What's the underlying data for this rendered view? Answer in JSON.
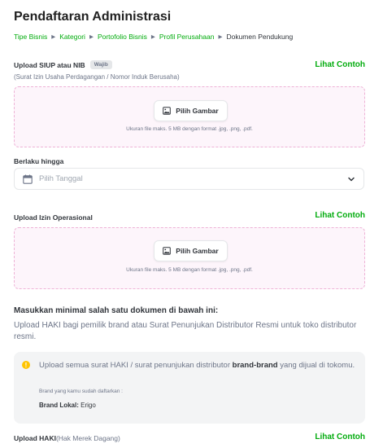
{
  "page": {
    "title": "Pendaftaran Administrasi"
  },
  "breadcrumb": [
    {
      "label": "Tipe Bisnis"
    },
    {
      "label": "Kategori"
    },
    {
      "label": "Portofolio Bisnis"
    },
    {
      "label": "Profil Perusahaan"
    },
    {
      "label": "Dokumen Pendukung"
    }
  ],
  "siup": {
    "label": "Upload SIUP atau NIB",
    "badge": "Wajib",
    "subtext": "(Surat Izin Usaha Perdagangan / Nomor Induk Berusaha)",
    "example_link": "Lihat Contoh",
    "button_label": "Pilih Gambar",
    "hint": "Ukuran file maks. 5 MB dengan format .jpg, .png, .pdf."
  },
  "valid_until": {
    "label": "Berlaku hingga",
    "placeholder": "Pilih Tanggal"
  },
  "izin": {
    "label": "Upload Izin Operasional",
    "example_link": "Lihat Contoh",
    "button_label": "Pilih Gambar",
    "hint": "Ukuran file maks. 5 MB dengan format .jpg, .png, .pdf."
  },
  "min_docs": {
    "title": "Masukkan minimal salah satu dokumen di bawah ini:",
    "description": "Upload HAKI bagi pemilik brand atau Surat Penunjukan Distributor Resmi untuk toko distributor resmi."
  },
  "info": {
    "text_prefix": "Upload semua surat HAKI / surat penunjukan distributor ",
    "text_bold": "brand-brand",
    "text_suffix": " yang dijual di tokomu.",
    "small": "Brand yang kamu sudah daftarkan :",
    "brand_label": "Brand Lokal:",
    "brand_value": " Erigo"
  },
  "haki": {
    "label": "Upload HAKI",
    "note": " (Hak Merek Dagang)",
    "example_link": "Lihat Contoh"
  },
  "colors": {
    "accent": "#03ac0e",
    "dropzone_bg": "#fdf5fb",
    "dropzone_border": "#eeb2d6",
    "info_bg": "#f3f4f5",
    "warning": "#ffc400"
  },
  "icons": [
    "chevron-right-icon",
    "image-icon",
    "calendar-icon",
    "chevron-down-icon",
    "info-icon"
  ]
}
